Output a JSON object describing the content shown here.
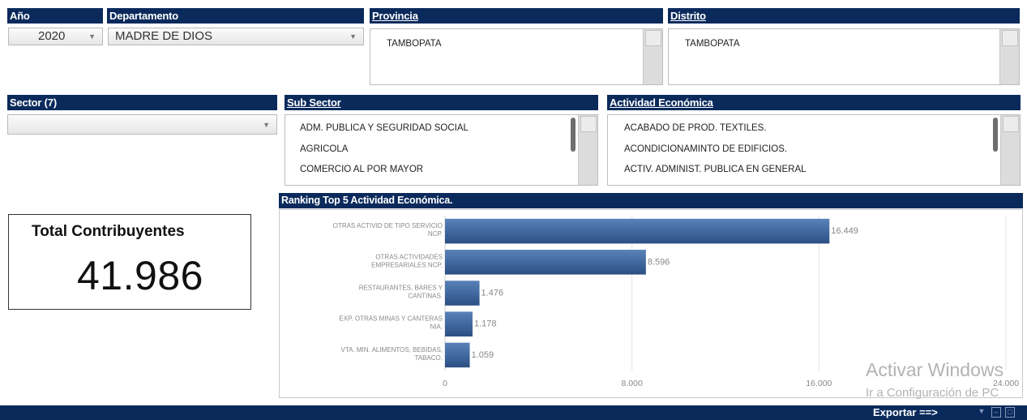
{
  "filters": {
    "anio": {
      "label": "Año",
      "value": "2020"
    },
    "departamento": {
      "label": "Departamento",
      "value": "MADRE DE DIOS"
    },
    "provincia": {
      "label": "Provincia",
      "items": [
        "TAMBOPATA"
      ]
    },
    "distrito": {
      "label": "Distrito",
      "items": [
        "TAMBOPATA"
      ]
    },
    "sector": {
      "label": "Sector (7)",
      "value": ""
    },
    "sub_sector": {
      "label": "Sub Sector",
      "items": [
        "ADM. PUBLICA Y SEGURIDAD SOCIAL",
        "AGRICOLA",
        "COMERCIO AL POR MAYOR"
      ]
    },
    "actividad": {
      "label": "Actividad Económica",
      "items": [
        "ACABADO DE PROD. TEXTILES.",
        "ACONDICIONAMINTO DE EDIFICIOS.",
        "ACTIV. ADMINIST. PUBLICA EN GENERAL"
      ]
    }
  },
  "kpi": {
    "label": "Total Contribuyentes",
    "value": "41.986"
  },
  "chart_data": {
    "type": "bar",
    "orientation": "horizontal",
    "title": "Ranking Top 5 Actividad Económica.",
    "categories": [
      [
        "OTRAS ACTIVID DE TIPO SERVICIO",
        "NCP."
      ],
      [
        "OTRAS ACTIVIDADES",
        "EMPRESARIALES NCP."
      ],
      [
        "RESTAURANTES, BARES Y",
        "CANTINAS."
      ],
      [
        "EXP. OTRAS MINAS Y CANTERAS",
        "NIA."
      ],
      [
        "VTA.  MIN. ALIMENTOS, BEBIDAS,",
        "TABACO."
      ]
    ],
    "values": [
      16449,
      8596,
      1476,
      1178,
      1059
    ],
    "value_labels": [
      "16.449",
      "8.596",
      "1.476",
      "1.178",
      "1.059"
    ],
    "xlim": [
      0,
      24000
    ],
    "xticks": [
      0,
      8000,
      16000,
      24000
    ],
    "xtick_labels": [
      "0",
      "8.000",
      "16.000",
      "24.000"
    ],
    "grid": "vertical",
    "bar_color": "#3f679e"
  },
  "footer": {
    "export_label": "Exportar ==>"
  },
  "watermark": {
    "line1": "Activar Windows",
    "line2": "Ir a Configuración de PC"
  },
  "colors": {
    "header": "#0b2a5c",
    "bar": "#3f679e"
  }
}
